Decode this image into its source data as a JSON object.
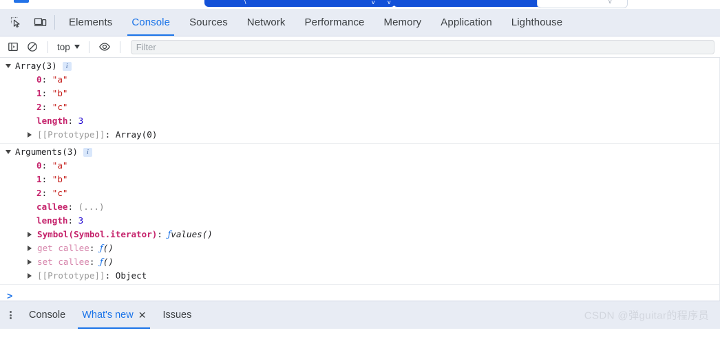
{
  "page_strip": {
    "buttons": [
      {
        "name": "pill-primary-1",
        "glyph": "✓"
      },
      {
        "name": "pill-primary-2",
        "glyph": ""
      },
      {
        "name": "pill-outline-1",
        "glyph": "⌄"
      }
    ]
  },
  "toolbar": {
    "inspect_icon": "inspect-element-icon",
    "device_icon": "device-toolbar-icon",
    "tabs": [
      {
        "label": "Elements",
        "active": false
      },
      {
        "label": "Console",
        "active": true
      },
      {
        "label": "Sources",
        "active": false
      },
      {
        "label": "Network",
        "active": false
      },
      {
        "label": "Performance",
        "active": false
      },
      {
        "label": "Memory",
        "active": false
      },
      {
        "label": "Application",
        "active": false
      },
      {
        "label": "Lighthouse",
        "active": false
      }
    ]
  },
  "console_toolbar": {
    "sidebar_icon": "console-sidebar-icon",
    "clear_icon": "clear-console-icon",
    "context": "top",
    "eye_icon": "live-expression-eye-icon",
    "filter_placeholder": "Filter",
    "filter_value": ""
  },
  "console": {
    "messages": [
      {
        "header": {
          "expanded": true,
          "label": "Array(3)",
          "badge": "i"
        },
        "rows": [
          {
            "arrow": "none",
            "key": "0",
            "key_kind": "index",
            "sep": ": ",
            "value": "\"a\"",
            "value_kind": "string"
          },
          {
            "arrow": "none",
            "key": "1",
            "key_kind": "index",
            "sep": ": ",
            "value": "\"b\"",
            "value_kind": "string"
          },
          {
            "arrow": "none",
            "key": "2",
            "key_kind": "index",
            "sep": ": ",
            "value": "\"c\"",
            "value_kind": "string"
          },
          {
            "arrow": "none",
            "key": "length",
            "key_kind": "own",
            "sep": ": ",
            "value": "3",
            "value_kind": "number"
          },
          {
            "arrow": "right",
            "key": "[[Prototype]]",
            "key_kind": "proto",
            "sep": ": ",
            "value": "Array(0)",
            "value_kind": "plain"
          }
        ]
      },
      {
        "header": {
          "expanded": true,
          "label": "Arguments(3)",
          "badge": "i"
        },
        "rows": [
          {
            "arrow": "none",
            "key": "0",
            "key_kind": "index",
            "sep": ": ",
            "value": "\"a\"",
            "value_kind": "string"
          },
          {
            "arrow": "none",
            "key": "1",
            "key_kind": "index",
            "sep": ": ",
            "value": "\"b\"",
            "value_kind": "string"
          },
          {
            "arrow": "none",
            "key": "2",
            "key_kind": "index",
            "sep": ": ",
            "value": "\"c\"",
            "value_kind": "string"
          },
          {
            "arrow": "none",
            "key": "callee",
            "key_kind": "own",
            "sep": ": ",
            "value": "(...)",
            "value_kind": "dots"
          },
          {
            "arrow": "none",
            "key": "length",
            "key_kind": "own",
            "sep": ": ",
            "value": "3",
            "value_kind": "number"
          },
          {
            "arrow": "right",
            "key": "Symbol(Symbol.iterator)",
            "key_kind": "symbol",
            "sep": ": ",
            "value": "values()",
            "value_kind": "function"
          },
          {
            "arrow": "right",
            "key": "get callee",
            "key_kind": "accessor",
            "sep": ": ",
            "value": "()",
            "value_kind": "function"
          },
          {
            "arrow": "right",
            "key": "set callee",
            "key_kind": "accessor",
            "sep": ": ",
            "value": "()",
            "value_kind": "function"
          },
          {
            "arrow": "right",
            "key": "[[Prototype]]",
            "key_kind": "proto",
            "sep": ": ",
            "value": "Object",
            "value_kind": "plain"
          }
        ]
      }
    ],
    "prompt": ">"
  },
  "drawer": {
    "menu_icon": "more-options-icon",
    "tabs": [
      {
        "label": "Console",
        "active": false,
        "closable": false
      },
      {
        "label": "What's new",
        "active": true,
        "closable": true
      },
      {
        "label": "Issues",
        "active": false,
        "closable": false
      }
    ],
    "close_glyph": "✕"
  },
  "watermark": {
    "text": "CSDN @弹guitar的程序员"
  },
  "colors": {
    "accent": "#1a73e8",
    "toolbar_bg": "#e8ecf4",
    "key_pink": "#c5226b",
    "string_red": "#c41a16",
    "number_blue": "#1c00cf"
  }
}
